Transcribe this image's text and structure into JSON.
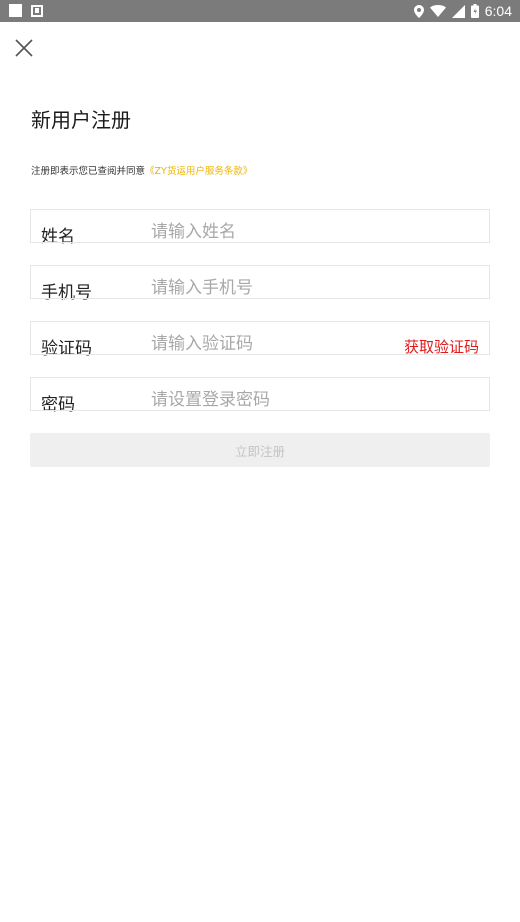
{
  "status_bar": {
    "time": "6:04"
  },
  "page": {
    "title": "新用户注册"
  },
  "terms": {
    "prefix": "注册即表示您已查阅并同意",
    "link": "《ZY货运用户服务条款》"
  },
  "form": {
    "name": {
      "label": "姓名",
      "placeholder": "请输入姓名"
    },
    "phone": {
      "label": "手机号",
      "placeholder": "请输入手机号"
    },
    "code": {
      "label": "验证码",
      "placeholder": "请输入验证码",
      "action": "获取验证码"
    },
    "password": {
      "label": "密码",
      "placeholder": "请设置登录密码"
    }
  },
  "submit_label": "立即注册",
  "colors": {
    "accent_link": "#f0b400",
    "code_button": "#e01b1b",
    "status_bar": "#7b7b7b"
  }
}
